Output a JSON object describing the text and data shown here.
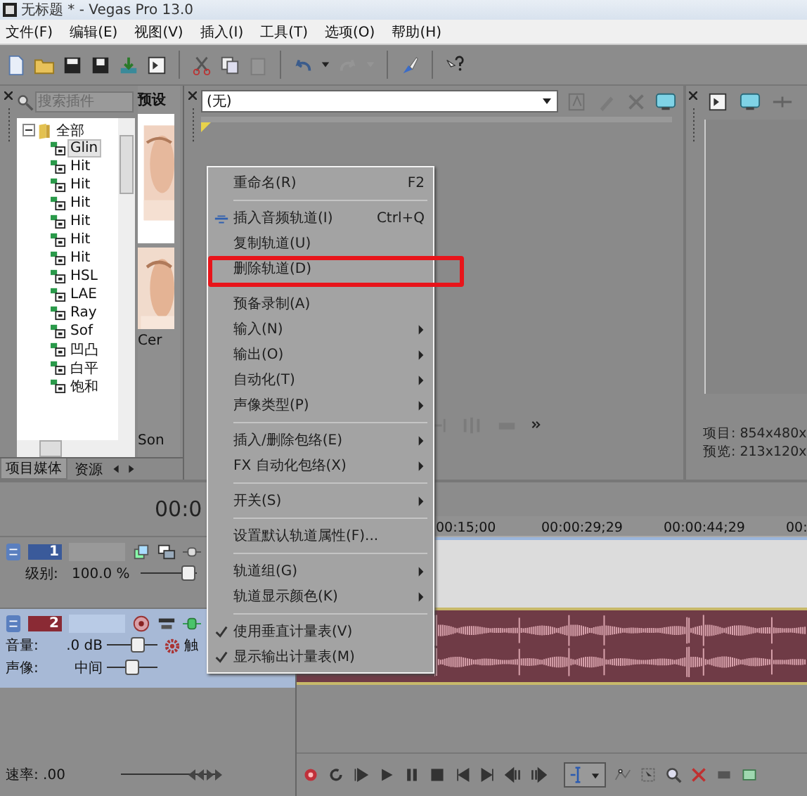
{
  "window": {
    "title": "无标题 * - Vegas Pro 13.0"
  },
  "menu_bar": [
    "文件(F)",
    "编辑(E)",
    "视图(V)",
    "插入(I)",
    "工具(T)",
    "选项(O)",
    "帮助(H)"
  ],
  "plugin_panel": {
    "search": {
      "placeholder": "搜索插件"
    },
    "tree": [
      {
        "label": "全部",
        "expanded": true,
        "selected": false,
        "children": [
          {
            "label": "Glin",
            "selected": true
          },
          {
            "label": "Hit",
            "selected": false
          },
          {
            "label": "Hit",
            "selected": false
          },
          {
            "label": "Hit",
            "selected": false
          },
          {
            "label": "Hit",
            "selected": false
          },
          {
            "label": "Hit",
            "selected": false
          },
          {
            "label": "Hit",
            "selected": false
          },
          {
            "label": "HSL",
            "selected": false
          },
          {
            "label": "LAE",
            "selected": false
          },
          {
            "label": "Ray",
            "selected": false
          },
          {
            "label": "Sof",
            "selected": false
          },
          {
            "label": "凹凸",
            "selected": false
          },
          {
            "label": "白平",
            "selected": false
          },
          {
            "label": "饱和",
            "selected": false
          }
        ]
      }
    ],
    "tabs": [
      {
        "label": "项目媒体",
        "selected": true
      },
      {
        "label": "资源",
        "selected": false
      }
    ]
  },
  "presets": {
    "title": "预设",
    "labels": [
      "Cer",
      "Son"
    ]
  },
  "fx_panel": {
    "dropdown": "(无)"
  },
  "preview_panel": {
    "project": "项目: 854x480x",
    "preview": "预览: 213x120x"
  },
  "timeline": {
    "time": "00:0",
    "ruler": [
      "00:15;00",
      "00:00:29;29",
      "00:00:44;29",
      "00:"
    ],
    "tracks": [
      {
        "kind": "video",
        "number": "1",
        "selected": false,
        "controls": [
          {
            "label": "级别:",
            "value": "100.0 %",
            "level": 0.85
          }
        ]
      },
      {
        "kind": "audio",
        "number": "2",
        "selected": true,
        "extra": "触",
        "controls": [
          {
            "label": "音量:",
            "value": ".0 dB",
            "level": 0.6
          },
          {
            "label": "声像:",
            "value": "中间",
            "level": 0.5
          }
        ]
      }
    ],
    "rate": "速率: .00",
    "rate_control": {
      "level": 0.85
    }
  },
  "context_menu": [
    {
      "kind": "item",
      "label": "重命名(R)",
      "shortcut": "F2"
    },
    {
      "kind": "separator"
    },
    {
      "kind": "item",
      "label": "插入音频轨道(I)",
      "shortcut": "Ctrl+Q",
      "icon": true
    },
    {
      "kind": "item",
      "label": "复制轨道(U)"
    },
    {
      "kind": "item",
      "label": "删除轨道(D)",
      "highlighted": true
    },
    {
      "kind": "separator"
    },
    {
      "kind": "item",
      "label": "预备录制(A)"
    },
    {
      "kind": "item",
      "label": "输入(N)",
      "submenu": true
    },
    {
      "kind": "item",
      "label": "输出(O)",
      "submenu": true
    },
    {
      "kind": "item",
      "label": "自动化(T)",
      "submenu": true
    },
    {
      "kind": "item",
      "label": "声像类型(P)",
      "submenu": true
    },
    {
      "kind": "separator"
    },
    {
      "kind": "item",
      "label": "插入/删除包络(E)",
      "submenu": true
    },
    {
      "kind": "item",
      "label": "FX 自动化包络(X)",
      "submenu": true
    },
    {
      "kind": "separator"
    },
    {
      "kind": "item",
      "label": "开关(S)",
      "submenu": true
    },
    {
      "kind": "separator"
    },
    {
      "kind": "item",
      "label": "设置默认轨道属性(F)..."
    },
    {
      "kind": "separator"
    },
    {
      "kind": "item",
      "label": "轨道组(G)",
      "submenu": true
    },
    {
      "kind": "item",
      "label": "轨道显示颜色(K)",
      "submenu": true
    },
    {
      "kind": "separator"
    },
    {
      "kind": "item",
      "label": "使用垂直计量表(V)",
      "checked": true
    },
    {
      "kind": "item",
      "label": "显示输出计量表(M)",
      "checked": true
    }
  ]
}
